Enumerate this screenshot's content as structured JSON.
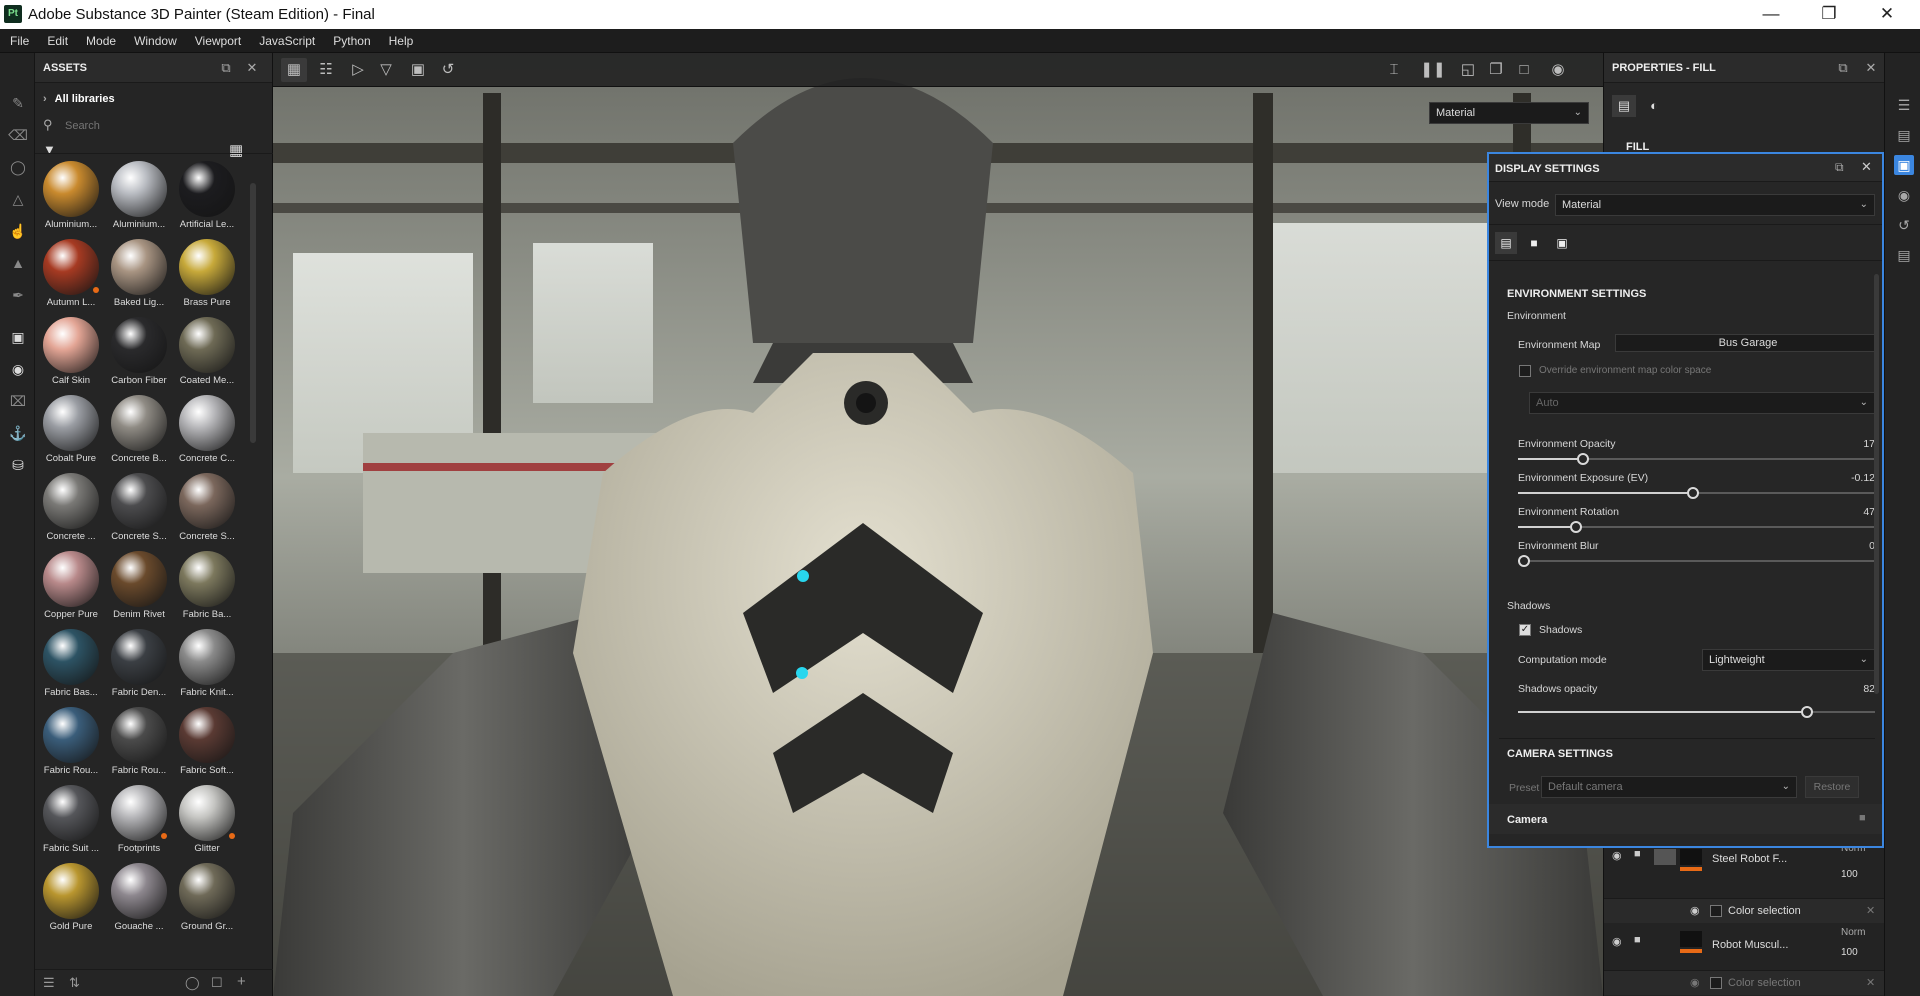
{
  "window": {
    "title": "Adobe Substance 3D Painter (Steam Edition) - Final",
    "logo": "Pt"
  },
  "menu": [
    "File",
    "Edit",
    "Mode",
    "Window",
    "Viewport",
    "JavaScript",
    "Python",
    "Help"
  ],
  "assets": {
    "title": "ASSETS",
    "library": "All libraries",
    "search_placeholder": "Search",
    "items": [
      {
        "label": "Aluminium...",
        "color": "#c98a2e",
        "dot": false
      },
      {
        "label": "Aluminium...",
        "color": "#b9bcc2",
        "dot": false
      },
      {
        "label": "Artificial Le...",
        "color": "#1c1c1f",
        "dot": false
      },
      {
        "label": "Autumn L...",
        "color": "#a63a22",
        "dot": true
      },
      {
        "label": "Baked Lig...",
        "color": "#a89482",
        "dot": false
      },
      {
        "label": "Brass Pure",
        "color": "#c7a93a",
        "dot": false
      },
      {
        "label": "Calf Skin",
        "color": "#e3a595",
        "dot": false
      },
      {
        "label": "Carbon Fiber",
        "color": "#2a2a2c",
        "dot": false
      },
      {
        "label": "Coated Me...",
        "color": "#6e6a55",
        "dot": false
      },
      {
        "label": "Cobalt Pure",
        "color": "#9a9da3",
        "dot": false
      },
      {
        "label": "Concrete B...",
        "color": "#8f8b84",
        "dot": false
      },
      {
        "label": "Concrete C...",
        "color": "#b7b7ba",
        "dot": false
      },
      {
        "label": "Concrete ...",
        "color": "#7a7976",
        "dot": false
      },
      {
        "label": "Concrete S...",
        "color": "#4c4c4e",
        "dot": false
      },
      {
        "label": "Concrete S...",
        "color": "#7b675c",
        "dot": false
      },
      {
        "label": "Copper Pure",
        "color": "#b8898a",
        "dot": false
      },
      {
        "label": "Denim Rivet",
        "color": "#6a4a2c",
        "dot": false
      },
      {
        "label": "Fabric Ba...",
        "color": "#7c785d",
        "dot": false
      },
      {
        "label": "Fabric Bas...",
        "color": "#2d5364",
        "dot": false
      },
      {
        "label": "Fabric Den...",
        "color": "#3b3f44",
        "dot": false
      },
      {
        "label": "Fabric Knit...",
        "color": "#8a8a8a",
        "dot": false
      },
      {
        "label": "Fabric Rou...",
        "color": "#3a5d7a",
        "dot": false
      },
      {
        "label": "Fabric Rou...",
        "color": "#4b4b4b",
        "dot": false
      },
      {
        "label": "Fabric Soft...",
        "color": "#5a3a33",
        "dot": false
      },
      {
        "label": "Fabric Suit ...",
        "color": "#55565a",
        "dot": false
      },
      {
        "label": "Footprints",
        "color": "#b5b5b8",
        "dot": true
      },
      {
        "label": "Glitter",
        "color": "#c5c5c2",
        "dot": true
      },
      {
        "label": "Gold Pure",
        "color": "#b9962f",
        "dot": false
      },
      {
        "label": "Gouache ...",
        "color": "#8d878e",
        "dot": false
      },
      {
        "label": "Ground Gr...",
        "color": "#6f6a58",
        "dot": false
      }
    ]
  },
  "viewport": {
    "mode_select": "Material",
    "colors": {
      "bg_top": "#8c8f86",
      "bg_bottom": "#3e3f3a",
      "suit": "#cfcab8",
      "accent": "#28d6ee"
    }
  },
  "properties": {
    "title": "PROPERTIES - FILL",
    "section": "FILL"
  },
  "display_settings": {
    "title": "DISPLAY SETTINGS",
    "view_mode_label": "View mode",
    "view_mode": "Material",
    "env_header": "ENVIRONMENT SETTINGS",
    "environment_label": "Environment",
    "env_map_label": "Environment Map",
    "env_map": "Bus Garage",
    "override_label": "Override environment map color space",
    "auto": "Auto",
    "sliders": [
      {
        "label": "Environment Opacity",
        "value": "17",
        "fraction": 0.17
      },
      {
        "label": "Environment Exposure (EV)",
        "value": "-0.12",
        "fraction": 0.49
      },
      {
        "label": "Environment Rotation",
        "value": "47",
        "fraction": 0.15
      },
      {
        "label": "Environment Blur",
        "value": "0",
        "fraction": 0.0
      }
    ],
    "shadows_header": "Shadows",
    "shadows_check": "Shadows",
    "computation_label": "Computation mode",
    "computation": "Lightweight",
    "shadow_opacity_label": "Shadows opacity",
    "shadow_opacity": "82",
    "shadow_opacity_fraction": 0.82,
    "camera_header": "CAMERA SETTINGS",
    "preset_label": "Preset",
    "preset": "Default camera",
    "restore": "Restore",
    "camera_label": "Camera"
  },
  "layers": [
    {
      "name": "Steel Robot F...",
      "blend": "Norm",
      "opacity": "100",
      "mask": "Color selection"
    },
    {
      "name": "Robot Muscul...",
      "blend": "Norm",
      "opacity": "100",
      "mask": "Color selection"
    }
  ]
}
